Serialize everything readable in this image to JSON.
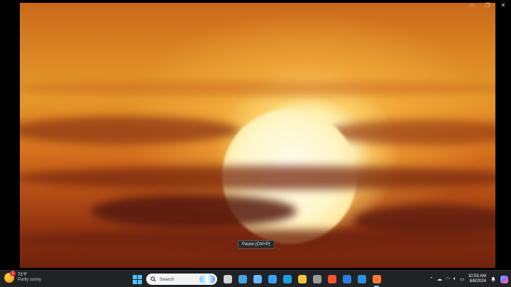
{
  "player": {
    "tooltip": "Pause (Ctrl+P)",
    "window_controls": [
      {
        "name": "minimize-icon",
        "glyph": "—"
      },
      {
        "name": "restore-icon",
        "glyph": "❐"
      },
      {
        "name": "close-icon",
        "glyph": "✕"
      }
    ]
  },
  "taskbar": {
    "weather": {
      "temperature": "71°F",
      "description": "Partly sunny",
      "badge": "1"
    },
    "search": {
      "placeholder": "Search"
    },
    "apps": [
      {
        "name": "task-view-icon",
        "color": "#cfd3d6"
      },
      {
        "name": "widgets-icon",
        "color": "#4aa3df"
      },
      {
        "name": "notepad-icon",
        "color": "#6bb6ff"
      },
      {
        "name": "photos-icon",
        "color": "#3aa0ff"
      },
      {
        "name": "edge-icon",
        "color": "#1b9de2"
      },
      {
        "name": "file-explorer-icon",
        "color": "#f4c542"
      },
      {
        "name": "media-app-icon",
        "color": "#9a9a9a"
      },
      {
        "name": "brave-icon",
        "color": "#fb542b"
      },
      {
        "name": "mail-icon",
        "color": "#2a7de1"
      },
      {
        "name": "calendar-icon",
        "color": "#2f8fe0"
      },
      {
        "name": "media-player-icon",
        "color": "#ff7a30"
      }
    ],
    "tray": {
      "time": "10:53 AM",
      "date": "6/8/2024"
    }
  }
}
